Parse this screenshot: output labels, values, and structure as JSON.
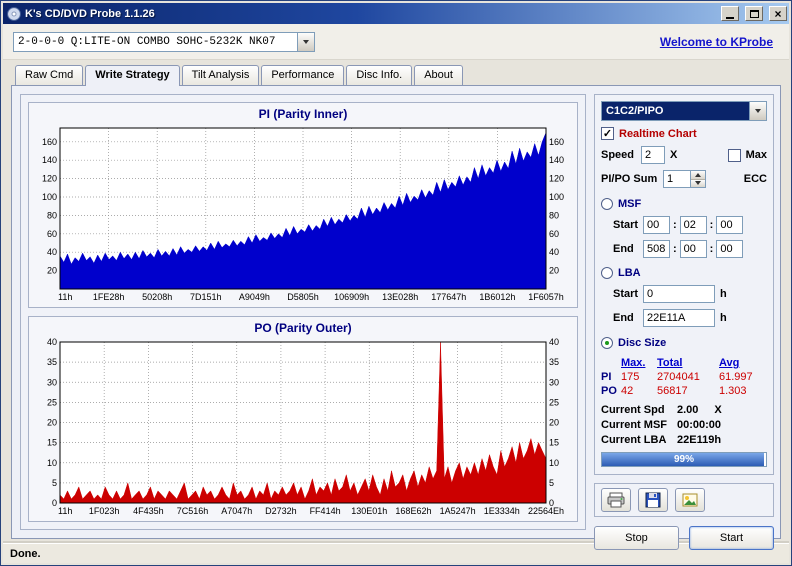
{
  "window": {
    "title": "K's CD/DVD Probe 1.1.26",
    "status": "Done."
  },
  "toolbar": {
    "drive": "2-0-0-0 Q:LITE-ON COMBO SOHC-5232K NK07",
    "link": "Welcome to KProbe"
  },
  "tabs": [
    {
      "label": "Raw Cmd"
    },
    {
      "label": "Write Strategy"
    },
    {
      "label": "Tilt Analysis"
    },
    {
      "label": "Performance"
    },
    {
      "label": "Disc Info."
    },
    {
      "label": "About"
    }
  ],
  "panel": {
    "mode": "C1C2/PIPO",
    "realtime": {
      "label": "Realtime Chart",
      "checked": true
    },
    "speed": {
      "label": "Speed",
      "value": "2",
      "times": "X",
      "max_label": "Max",
      "max_checked": false
    },
    "sum": {
      "label": "PI/PO Sum",
      "value": "1",
      "ecc": "ECC"
    },
    "msf": {
      "label": "MSF",
      "start_label": "Start",
      "end_label": "End",
      "sep": ":",
      "start": [
        "00",
        "02",
        "00"
      ],
      "end": [
        "508",
        "00",
        "00"
      ]
    },
    "lba": {
      "label": "LBA",
      "start_label": "Start",
      "end_label": "End",
      "start": "0",
      "end": "22E11A",
      "unit": "h"
    },
    "disc_size": {
      "label": "Disc Size",
      "selected": true
    },
    "stats": {
      "headers": [
        "Max.",
        "Total",
        "Avg"
      ],
      "rows": [
        {
          "name": "PI",
          "max": "175",
          "total": "2704041",
          "avg": "61.997"
        },
        {
          "name": "PO",
          "max": "42",
          "total": "56817",
          "avg": "1.303"
        }
      ]
    },
    "current": {
      "spd_label": "Current Spd",
      "spd": "2.00",
      "spd_unit": "X",
      "msf_label": "Current MSF",
      "msf": "00:00:00",
      "lba_label": "Current LBA",
      "lba": "22E119h"
    },
    "progress": {
      "percent": 99,
      "label": "99%"
    },
    "stop": "Stop",
    "start": "Start"
  },
  "chart_data": [
    {
      "type": "area",
      "title": "PI (Parity Inner)",
      "color": "#0000cc",
      "ylim": [
        0,
        175
      ],
      "ymax": 175,
      "yticks": [
        20,
        40,
        60,
        80,
        100,
        120,
        140,
        160
      ],
      "grid": true,
      "xlabels": [
        "11h",
        "1FE28h",
        "50208h",
        "7D151h",
        "A9049h",
        "D5805h",
        "106909h",
        "13E028h",
        "177647h",
        "1B6012h",
        "1F6057h"
      ],
      "values": [
        36,
        29,
        38,
        27,
        34,
        30,
        39,
        31,
        35,
        28,
        37,
        30,
        39,
        32,
        36,
        31,
        40,
        33,
        38,
        32,
        40,
        33,
        42,
        35,
        39,
        34,
        43,
        36,
        41,
        36,
        44,
        37,
        46,
        39,
        43,
        40,
        47,
        41,
        46,
        42,
        50,
        43,
        52,
        45,
        49,
        46,
        53,
        47,
        52,
        48,
        57,
        50,
        59,
        52,
        56,
        53,
        61,
        55,
        60,
        56,
        66,
        58,
        68,
        60,
        65,
        62,
        70,
        63,
        69,
        65,
        76,
        68,
        78,
        70,
        76,
        72,
        81,
        74,
        80,
        76,
        88,
        78,
        90,
        81,
        88,
        83,
        94,
        86,
        93,
        88,
        101,
        91,
        104,
        94,
        101,
        97,
        108,
        99,
        107,
        102,
        116,
        105,
        119,
        108,
        116,
        111,
        123,
        113,
        122,
        116,
        132,
        120,
        135,
        123,
        132,
        126,
        140,
        128,
        138,
        131,
        150,
        136,
        153,
        139,
        149,
        143,
        158,
        145,
        160,
        170
      ]
    },
    {
      "type": "area",
      "title": "PO (Parity Outer)",
      "color": "#cc0000",
      "ylim": [
        0,
        40
      ],
      "ymax": 40,
      "yticks": [
        0,
        5,
        10,
        15,
        20,
        25,
        30,
        35,
        40
      ],
      "grid": true,
      "xlabels": [
        "11h",
        "1F023h",
        "4F435h",
        "7C516h",
        "A7047h",
        "D2732h",
        "FF414h",
        "130E01h",
        "168E62h",
        "1A5247h",
        "1E3334h",
        "22564Eh"
      ],
      "values": [
        2,
        1,
        3,
        1,
        2,
        4,
        1,
        2,
        3,
        1,
        2,
        1,
        4,
        2,
        1,
        3,
        1,
        2,
        5,
        1,
        2,
        3,
        1,
        2,
        4,
        1,
        3,
        2,
        1,
        3,
        2,
        1,
        3,
        5,
        1,
        2,
        3,
        1,
        4,
        2,
        3,
        1,
        2,
        4,
        2,
        1,
        5,
        2,
        3,
        1,
        2,
        4,
        1,
        3,
        2,
        5,
        1,
        3,
        2,
        4,
        2,
        3,
        5,
        2,
        4,
        1,
        3,
        6,
        2,
        4,
        3,
        5,
        2,
        6,
        3,
        4,
        7,
        3,
        5,
        2,
        4,
        6,
        3,
        7,
        4,
        2,
        6,
        3,
        8,
        4,
        5,
        7,
        3,
        6,
        8,
        4,
        7,
        5,
        9,
        6,
        8,
        40,
        6,
        9,
        5,
        8,
        10,
        6,
        9,
        7,
        10,
        7,
        11,
        8,
        12,
        9,
        7,
        13,
        9,
        11,
        14,
        10,
        15,
        11,
        13,
        16,
        12,
        15,
        13,
        11
      ]
    }
  ]
}
